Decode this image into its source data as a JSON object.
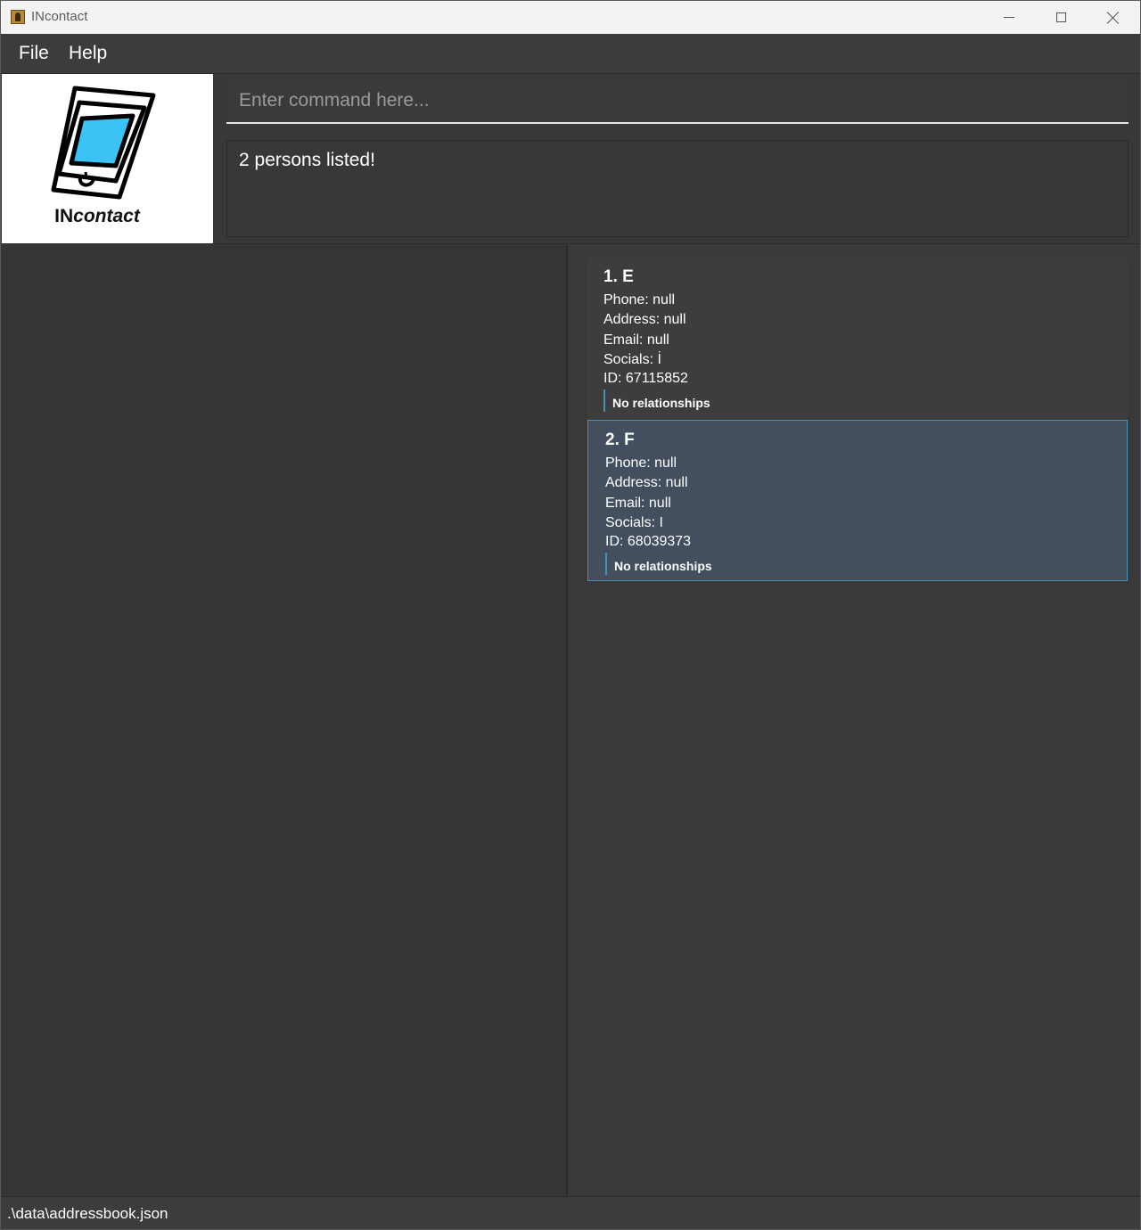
{
  "window": {
    "title": "INcontact",
    "controls": [
      "minimize-icon",
      "maximize-icon",
      "close-icon"
    ]
  },
  "menu": {
    "file": "File",
    "help": "Help"
  },
  "logo": {
    "text_prefix": "IN",
    "text_suffix": "contact",
    "accent_color": "#3cc3f5"
  },
  "command": {
    "placeholder": "Enter command here...",
    "value": ""
  },
  "result": {
    "message": "2 persons listed!"
  },
  "persons": [
    {
      "name": "1. E",
      "phone": "Phone: null",
      "address": "Address: null",
      "email": "Email: null",
      "socials": "Socials: İ",
      "id": "ID: 67115852",
      "relationships": "No relationships"
    },
    {
      "name": "2. F",
      "phone": "Phone: null",
      "address": "Address: null",
      "email": "Email: null",
      "socials": "Socials: I",
      "id": "ID: 68039373",
      "relationships": "No relationships",
      "selected": true
    }
  ],
  "status": {
    "path": ".\\data\\addressbook.json"
  },
  "colors": {
    "background": "#383838",
    "selected_card": "#434f5f",
    "selected_border": "#4a8fb4",
    "text": "#ffffff"
  }
}
